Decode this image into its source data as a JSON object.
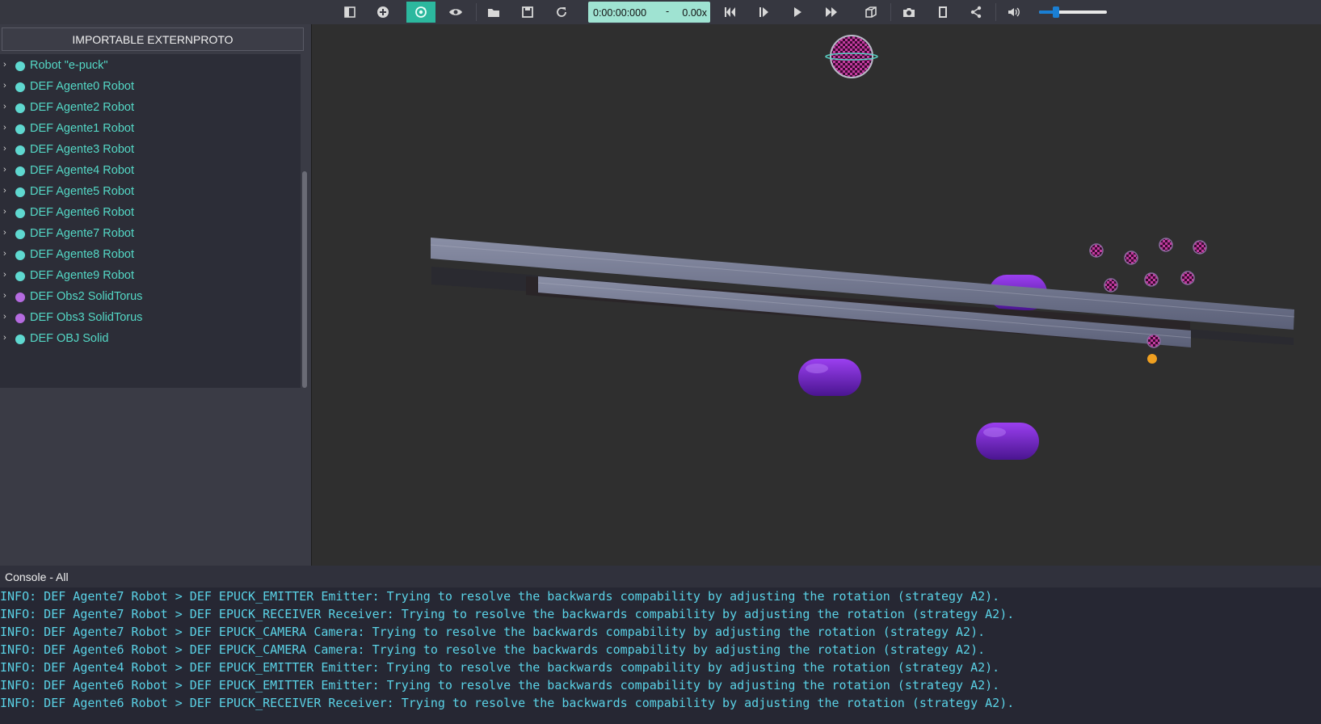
{
  "toolbar": {
    "buttons": [
      {
        "id": "toggle-panel",
        "icon": "sidebar-icon"
      },
      {
        "id": "add-node",
        "icon": "plus-circle-icon"
      },
      {
        "id": "viewpoint-follow",
        "icon": "rotate-view-icon",
        "active": true
      },
      {
        "id": "view-options",
        "icon": "eye-icon"
      },
      {
        "id": "open-world",
        "icon": "folder-icon"
      },
      {
        "id": "save-world",
        "icon": "save-icon"
      },
      {
        "id": "reload-world",
        "icon": "reload-icon"
      },
      {
        "id": "reset-simulation",
        "icon": "skip-back-icon"
      },
      {
        "id": "step",
        "icon": "step-icon"
      },
      {
        "id": "play",
        "icon": "play-icon"
      },
      {
        "id": "fast-forward",
        "icon": "fast-forward-icon"
      },
      {
        "id": "rendering",
        "icon": "cube-icon"
      },
      {
        "id": "screenshot",
        "icon": "camera-icon"
      },
      {
        "id": "record-movie",
        "icon": "film-icon"
      },
      {
        "id": "share",
        "icon": "share-icon"
      },
      {
        "id": "sound",
        "icon": "volume-icon"
      }
    ],
    "time": "0:00:00:000",
    "time_dash": "-",
    "speed": "0.00x",
    "volume_level": 0.25,
    "accent_color": "#2cb89e"
  },
  "scene_tree": {
    "import_button_label": "IMPORTABLE EXTERNPROTO",
    "items": [
      {
        "label": "Robot \"e-puck\"",
        "kind": "robot"
      },
      {
        "label": "DEF Agente0 Robot",
        "kind": "robot"
      },
      {
        "label": "DEF Agente2 Robot",
        "kind": "robot"
      },
      {
        "label": "DEF Agente1 Robot",
        "kind": "robot"
      },
      {
        "label": "DEF Agente3 Robot",
        "kind": "robot"
      },
      {
        "label": "DEF Agente4 Robot",
        "kind": "robot"
      },
      {
        "label": "DEF Agente5 Robot",
        "kind": "robot"
      },
      {
        "label": "DEF Agente6 Robot",
        "kind": "robot"
      },
      {
        "label": "DEF Agente7 Robot",
        "kind": "robot"
      },
      {
        "label": "DEF Agente8 Robot",
        "kind": "robot"
      },
      {
        "label": "DEF Agente9 Robot",
        "kind": "robot"
      },
      {
        "label": "DEF Obs2 SolidTorus",
        "kind": "solid"
      },
      {
        "label": "DEF Obs3 SolidTorus",
        "kind": "solid"
      },
      {
        "label": "DEF OBJ Solid",
        "kind": "robot"
      }
    ],
    "robot_color": "#5fd8d0",
    "solid_color": "#b56be0"
  },
  "console": {
    "title": "Console - All",
    "lines": [
      "INFO: DEF Agente7 Robot > DEF EPUCK_EMITTER Emitter: Trying to resolve the backwards compability by adjusting the rotation (strategy A2).",
      "INFO: DEF Agente7 Robot > DEF EPUCK_RECEIVER Receiver: Trying to resolve the backwards compability by adjusting the rotation (strategy A2).",
      "INFO: DEF Agente7 Robot > DEF EPUCK_CAMERA Camera: Trying to resolve the backwards compability by adjusting the rotation (strategy A2).",
      "INFO: DEF Agente6 Robot > DEF EPUCK_CAMERA Camera: Trying to resolve the backwards compability by adjusting the rotation (strategy A2).",
      "INFO: DEF Agente4 Robot > DEF EPUCK_EMITTER Emitter: Trying to resolve the backwards compability by adjusting the rotation (strategy A2).",
      "INFO: DEF Agente6 Robot > DEF EPUCK_EMITTER Emitter: Trying to resolve the backwards compability by adjusting the rotation (strategy A2).",
      "INFO: DEF Agente6 Robot > DEF EPUCK_RECEIVER Receiver: Trying to resolve the backwards compability by adjusting the rotation (strategy A2)."
    ]
  }
}
